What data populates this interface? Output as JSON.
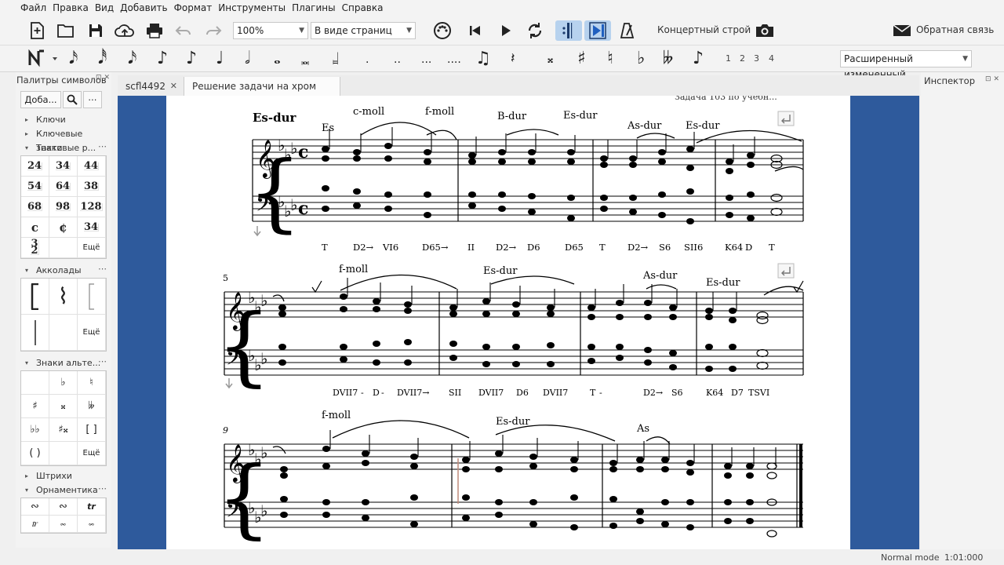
{
  "menu": [
    "Файл",
    "Правка",
    "Вид",
    "Добавить",
    "Формат",
    "Инструменты",
    "Плагины",
    "Справка"
  ],
  "toolbar": {
    "zoom": "100%",
    "view_mode": "В виде страниц",
    "concert_pitch": "Концертный строй",
    "feedback": "Обратная связь",
    "workspace": "Расширенный измененный",
    "voices": [
      "1",
      "2",
      "3",
      "4"
    ]
  },
  "palettes": {
    "title": "Палитры символов",
    "add_button": "Доба...",
    "sections": {
      "clefs": "Ключи",
      "key_signatures": "Ключевые знаки",
      "time_signatures": "Тактовые р...",
      "brackets": "Акколады",
      "accidentals": "Знаки альте...",
      "articulations": "Штрихи",
      "ornaments": "Орнаментика"
    },
    "time_sigs": [
      [
        "2",
        "4"
      ],
      [
        "3",
        "4"
      ],
      [
        "4",
        "4"
      ],
      [
        "5",
        "4"
      ],
      [
        "6",
        "4"
      ],
      [
        "3",
        "8"
      ],
      [
        "6",
        "8"
      ],
      [
        "9",
        "8"
      ],
      [
        "12",
        "8"
      ]
    ],
    "common_time": "𝄴",
    "cut_time": "𝄵",
    "more": "Ещё"
  },
  "tabs": [
    {
      "label": "scfl4492"
    },
    {
      "label": "Решение задачи на хром секв"
    }
  ],
  "inspector": {
    "title": "Инспектор"
  },
  "score": {
    "truncated_header": "Задача 103 по учебн...",
    "key_label": "Es-dur",
    "system1": {
      "keys": [
        "Es",
        "c-moll",
        "f-moll",
        "B-dur",
        "Es-dur",
        "As-dur",
        "Es-dur"
      ],
      "harmony": [
        "T",
        "D2→",
        "VI6",
        "D65→",
        "II",
        "D2→",
        "D6",
        "D65",
        "T",
        "D2→",
        "S6",
        "SII6",
        "K64",
        "D",
        "T"
      ]
    },
    "system2": {
      "measure_number": "5",
      "keys": [
        "f-moll",
        "Es-dur",
        "As-dur",
        "Es-dur"
      ],
      "harmony": [
        "DVII7",
        "-",
        "D",
        "-",
        "DVII7→",
        "SII",
        "DVII7",
        "D6",
        "DVII7",
        "T",
        "-",
        "D2→",
        "S6",
        "K64",
        "D7",
        "TSVI"
      ]
    },
    "system3": {
      "measure_number": "9",
      "keys": [
        "f-moll",
        "Es-dur",
        "As"
      ]
    }
  },
  "status": {
    "mode": "Normal mode",
    "time": "1:01:000"
  }
}
